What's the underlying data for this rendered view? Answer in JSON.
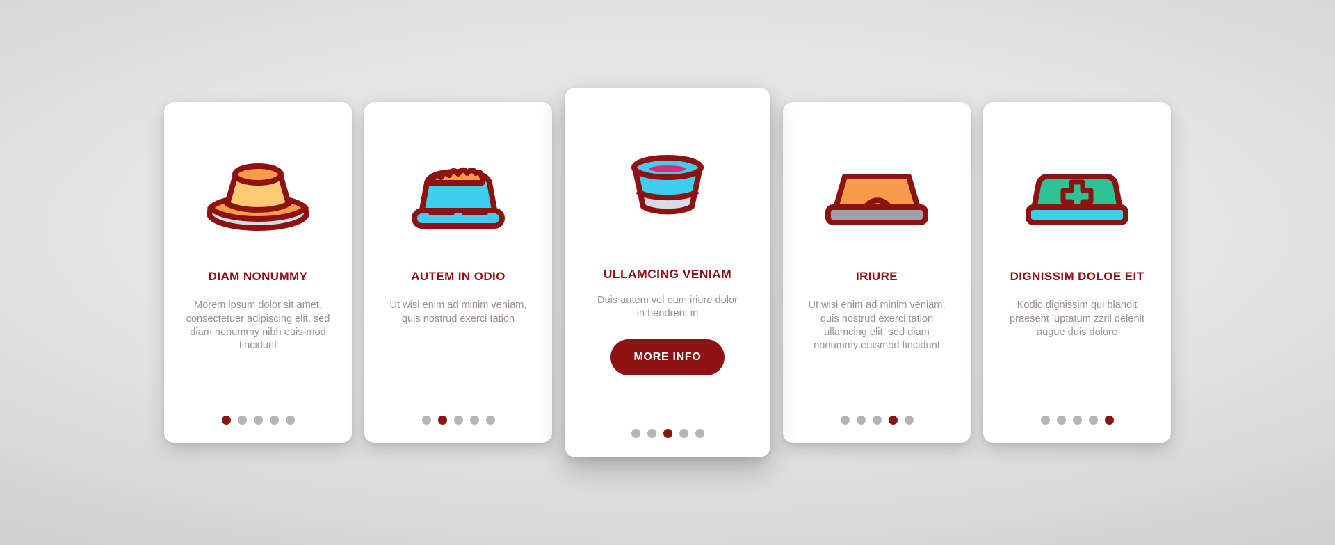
{
  "theme": {
    "accent": "#8d1212",
    "body_text": "#9b8e98",
    "dot_inactive": "#b6b6b6",
    "card_bg": "#ffffff",
    "page_bg": "#d8d8d8"
  },
  "cards": [
    {
      "id": "card-diam-nonummy",
      "icon": "pet-bowl-flan-icon",
      "title": "DIAM NONUMMY",
      "body": "Morem ipsum dolor sit amet, consectetuer adipiscing elit, sed diam nonummy nibh euis-mod tincidunt",
      "featured": false,
      "dots": {
        "count": 5,
        "active_index": 0
      }
    },
    {
      "id": "card-autem-in-odio",
      "icon": "pet-food-bowl-kibble-icon",
      "title": "AUTEM IN ODIO",
      "body": "Ut wisi enim ad minim veniam, quis nostrud exerci tation",
      "featured": false,
      "dots": {
        "count": 5,
        "active_index": 1
      }
    },
    {
      "id": "card-ullamcing-veniam",
      "icon": "water-bowl-icon",
      "title": "ULLAMCING VENIAM",
      "body": "Duis autem vel eum iriure dolor in hendrerit in",
      "featured": true,
      "button_label": "MORE INFO",
      "dots": {
        "count": 5,
        "active_index": 2
      }
    },
    {
      "id": "card-iriure",
      "icon": "pet-house-bed-icon",
      "title": "IRIURE",
      "body": "Ut wisi enim ad minim veniam, quis nostrud exerci tation ullamcing elit, sed diam nonummy euismod tincidunt",
      "featured": false,
      "dots": {
        "count": 5,
        "active_index": 3
      }
    },
    {
      "id": "card-dignissim-doloe-eit",
      "icon": "vet-medical-bed-icon",
      "title": "DIGNISSIM DOLOE EIT",
      "body": "Kodio dignissim qui blandit praesent luptatum zzril delenit augue duis dolore",
      "featured": false,
      "dots": {
        "count": 5,
        "active_index": 4
      }
    }
  ]
}
